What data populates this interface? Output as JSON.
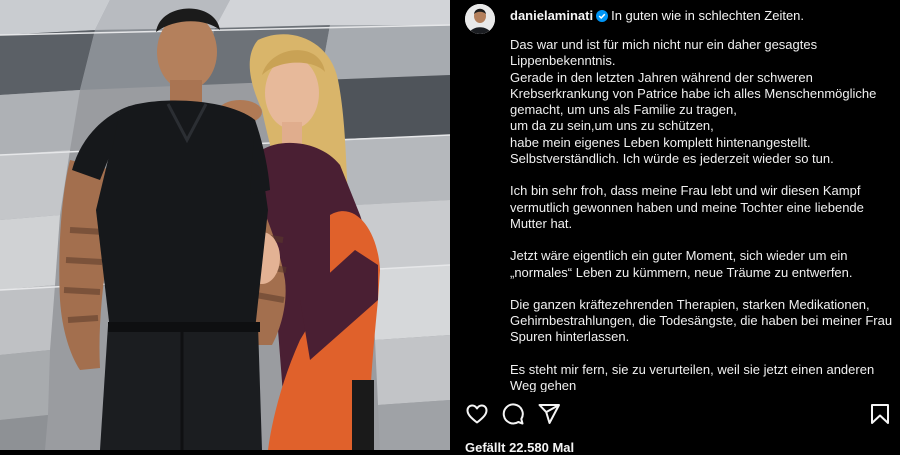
{
  "post": {
    "username": "danielaminati",
    "caption_title": "In guten wie in schlechten Zeiten.",
    "paragraphs": [
      "Das war und ist für mich nicht nur ein daher gesagtes\nLippenbekenntnis.\nGerade in den letzten Jahren während der schweren\nKrebserkrankung von Patrice  habe ich alles Menschenmögliche\ngemacht, um uns als Familie zu tragen,\num da zu sein,um uns zu schützen,\nhabe mein eigenes Leben komplett hintenangestellt.\nSelbstverständlich. Ich würde es jederzeit wieder so tun.",
      "Ich bin sehr froh, dass meine Frau lebt und wir diesen Kampf\nvermutlich gewonnen haben und meine Tochter eine  liebende\nMutter hat.",
      " Jetzt wäre eigentlich  ein guter Moment, sich wieder um ein\n„normales“ Leben zu kümmern, neue Träume zu entwerfen.",
      "Die ganzen kräftezehrenden Therapien, starken Medikationen,\nGehirnbestrahlungen, die Todesängste, die haben bei meiner Frau\nSpuren hinterlassen.",
      "Es steht mir fern, sie zu verurteilen, weil sie jetzt  einen anderen\nWeg gehen"
    ],
    "likes_text": "Gefällt 22.580 Mal"
  },
  "actions": {
    "like": "heart-icon",
    "comment": "comment-icon",
    "share": "share-icon",
    "save": "bookmark-icon"
  },
  "colors": {
    "background": "#000000",
    "text": "#f5f5f5",
    "verified": "#0095f6"
  }
}
